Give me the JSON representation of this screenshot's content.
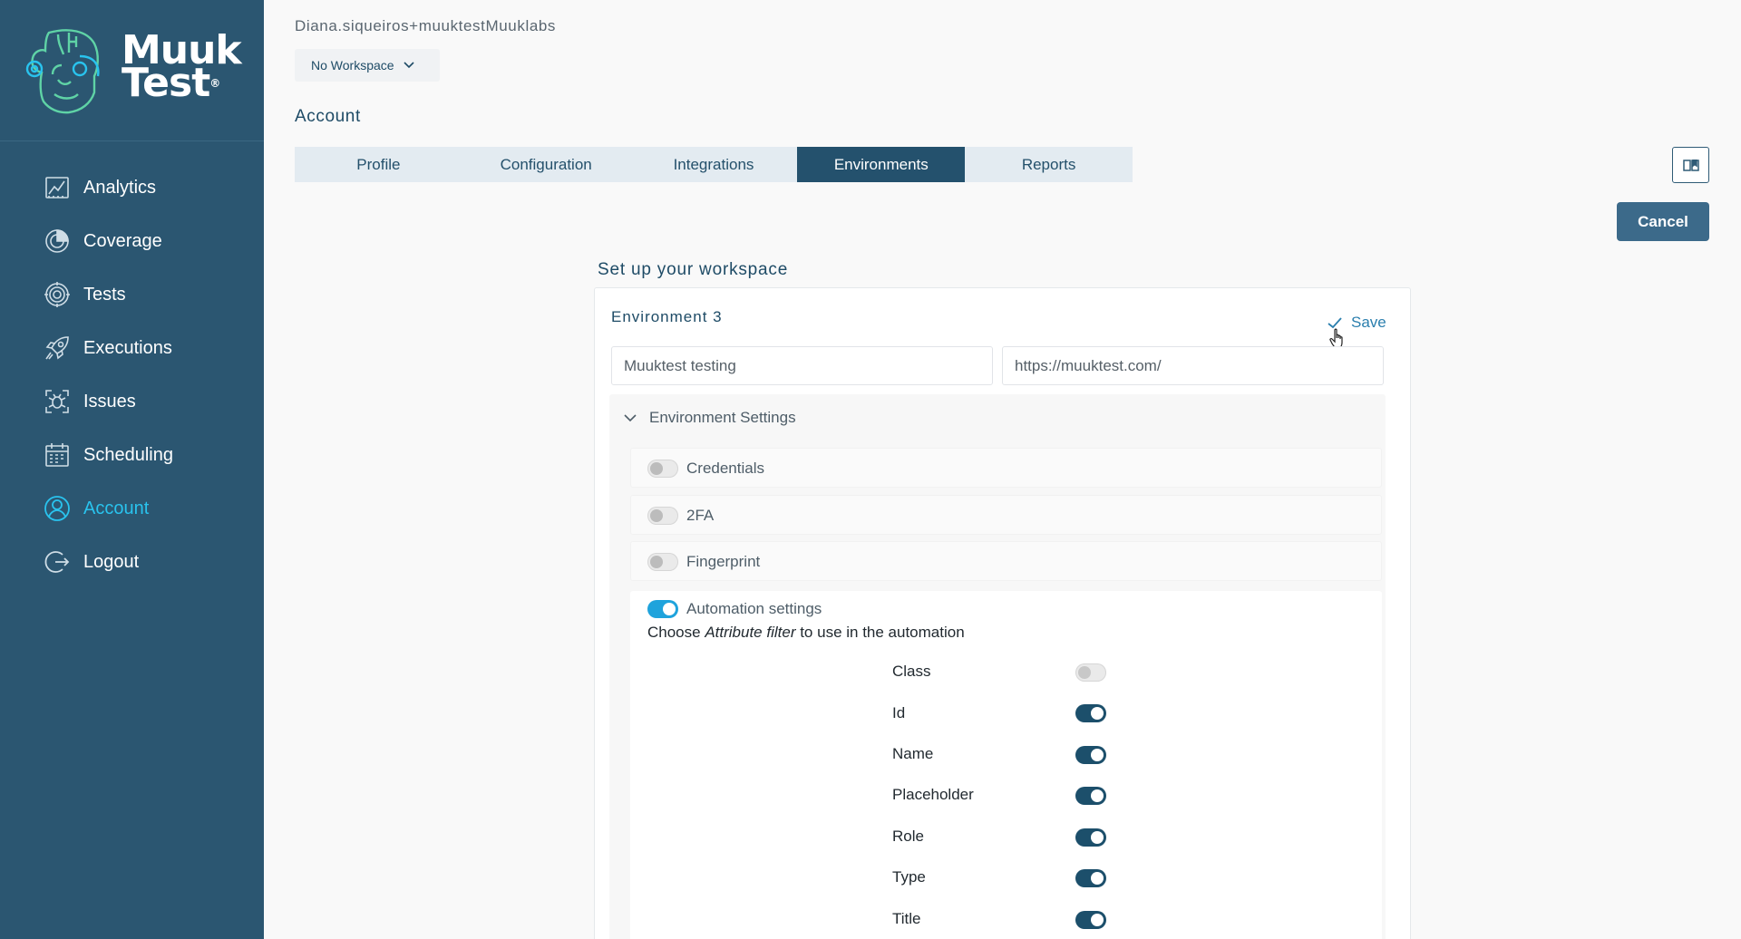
{
  "brand": {
    "line1": "Muuk",
    "line2": "Test",
    "registered": "®"
  },
  "sidebar": {
    "items": [
      {
        "label": "Analytics",
        "icon": "analytics-chart-icon"
      },
      {
        "label": "Coverage",
        "icon": "coverage-gauge-icon"
      },
      {
        "label": "Tests",
        "icon": "tests-target-icon"
      },
      {
        "label": "Executions",
        "icon": "rocket-icon"
      },
      {
        "label": "Issues",
        "icon": "bug-icon"
      },
      {
        "label": "Scheduling",
        "icon": "calendar-icon"
      },
      {
        "label": "Account",
        "icon": "user-icon",
        "active": true
      },
      {
        "label": "Logout",
        "icon": "logout-icon"
      }
    ]
  },
  "header": {
    "user": "Diana.siqueiros+muuktestMuuklabs",
    "workspace": "No Workspace",
    "page_title": "Account"
  },
  "tabs": [
    {
      "label": "Profile"
    },
    {
      "label": "Configuration"
    },
    {
      "label": "Integrations"
    },
    {
      "label": "Environments",
      "active": true
    },
    {
      "label": "Reports"
    }
  ],
  "actions": {
    "cancel": "Cancel",
    "save": "Save"
  },
  "workspace_setup": {
    "title": "Set up your workspace",
    "environment": {
      "title": "Environment 3",
      "name_value": "Muuktest testing",
      "url_value": "https://muuktest.com/"
    },
    "settings": {
      "title": "Environment Settings",
      "credentials": {
        "label": "Credentials",
        "enabled": false
      },
      "twofa": {
        "label": "2FA",
        "enabled": false
      },
      "fingerprint": {
        "label": "Fingerprint",
        "enabled": false
      },
      "automation": {
        "label": "Automation settings",
        "enabled": true,
        "choose_prefix": "Choose ",
        "choose_em": "Attribute filter",
        "choose_suffix": " to use in the automation",
        "attributes": [
          {
            "label": "Class",
            "enabled": false
          },
          {
            "label": "Id",
            "enabled": true
          },
          {
            "label": "Name",
            "enabled": true
          },
          {
            "label": "Placeholder",
            "enabled": true
          },
          {
            "label": "Role",
            "enabled": true
          },
          {
            "label": "Type",
            "enabled": true
          },
          {
            "label": "Title",
            "enabled": true
          }
        ]
      }
    }
  },
  "colors": {
    "sidebar": "#2b5671",
    "accent": "#29c3ee",
    "primary": "#24516d",
    "link": "#2b7fae"
  }
}
